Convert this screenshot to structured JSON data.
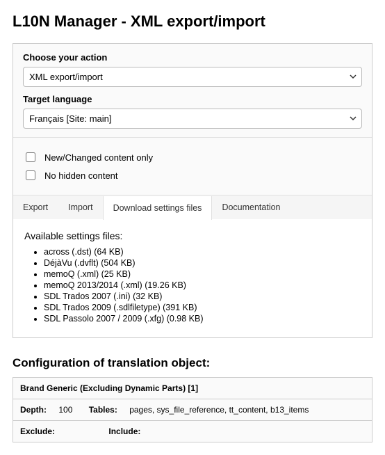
{
  "page": {
    "title": "L10N Manager - XML export/import"
  },
  "actionSection": {
    "label": "Choose your action",
    "selected": "XML export/import"
  },
  "languageSection": {
    "label": "Target language",
    "selected": "Français [Site: main]"
  },
  "options": {
    "newChanged": "New/Changed content only",
    "noHidden": "No hidden content"
  },
  "tabs": {
    "export": "Export",
    "import": "Import",
    "download": "Download settings files",
    "docs": "Documentation"
  },
  "download": {
    "heading": "Available settings files:",
    "files": [
      "across (.dst) (64 KB)",
      "DéjàVu (.dvflt) (504 KB)",
      "memoQ (.xml) (25 KB)",
      "memoQ 2013/2014 (.xml) (19.26 KB)",
      "SDL Trados 2007 (.ini) (32 KB)",
      "SDL Trados 2009 (.sdlfiletype) (391 KB)",
      "SDL Passolo 2007 / 2009 (.xfg) (0.98 KB)"
    ]
  },
  "config": {
    "heading": "Configuration of translation object:",
    "header": "Brand Generic (Excluding Dynamic Parts) [1]",
    "row1": {
      "depthLabel": "Depth:",
      "depthValue": "100",
      "tablesLabel": "Tables:",
      "tablesValue": "pages, sys_file_reference, tt_content, b13_items"
    },
    "row2": {
      "excludeLabel": "Exclude:",
      "excludeValue": "",
      "includeLabel": "Include:",
      "includeValue": ""
    }
  }
}
